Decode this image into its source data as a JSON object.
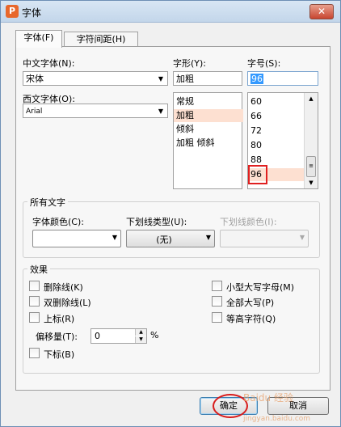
{
  "window": {
    "title": "字体",
    "app_icon": "P",
    "close_glyph": "✕"
  },
  "tabs": [
    {
      "label": "字体(F)"
    },
    {
      "label": "字符间距(H)"
    }
  ],
  "chinese_font": {
    "label": "中文字体(N):",
    "value": "宋体"
  },
  "western_font": {
    "label": "西文字体(O):",
    "value": "Arial"
  },
  "style": {
    "label": "字形(Y):",
    "value": "加粗",
    "options": [
      "常规",
      "加粗",
      "倾斜",
      "加粗 倾斜"
    ],
    "selected": "加粗"
  },
  "size": {
    "label": "字号(S):",
    "value": "96",
    "options": [
      "60",
      "66",
      "72",
      "80",
      "88",
      "96"
    ],
    "selected": "96"
  },
  "all_text": {
    "title": "所有文字",
    "font_color": {
      "label": "字体颜色(C):",
      "value": ""
    },
    "underline_type": {
      "label": "下划线类型(U):",
      "value": "(无)"
    },
    "underline_color": {
      "label": "下划线颜色(I):",
      "value": ""
    }
  },
  "effects": {
    "title": "效果",
    "strikethrough": {
      "label": "删除线(K)"
    },
    "double_strikethrough": {
      "label": "双删除线(L)"
    },
    "superscript": {
      "label": "上标(R)"
    },
    "offset": {
      "label": "偏移量(T):",
      "value": "0",
      "unit": "%"
    },
    "subscript": {
      "label": "下标(B)"
    },
    "small_caps": {
      "label": "小型大写字母(M)"
    },
    "all_caps": {
      "label": "全部大写(P)"
    },
    "equal_height": {
      "label": "等高字符(Q)"
    }
  },
  "buttons": {
    "ok": "确定",
    "cancel": "取消"
  },
  "watermark": {
    "text": "Baidu 经验",
    "sub": "jingyan.baidu.com"
  },
  "colors": {
    "highlight_selection": "#fde0d1",
    "annotation_red": "#e02020",
    "input_selection": "#3399ff"
  },
  "icons": {
    "combo_arrow": "▼",
    "scroll_up": "▲",
    "scroll_down": "▼",
    "scroll_grip": "≡"
  }
}
